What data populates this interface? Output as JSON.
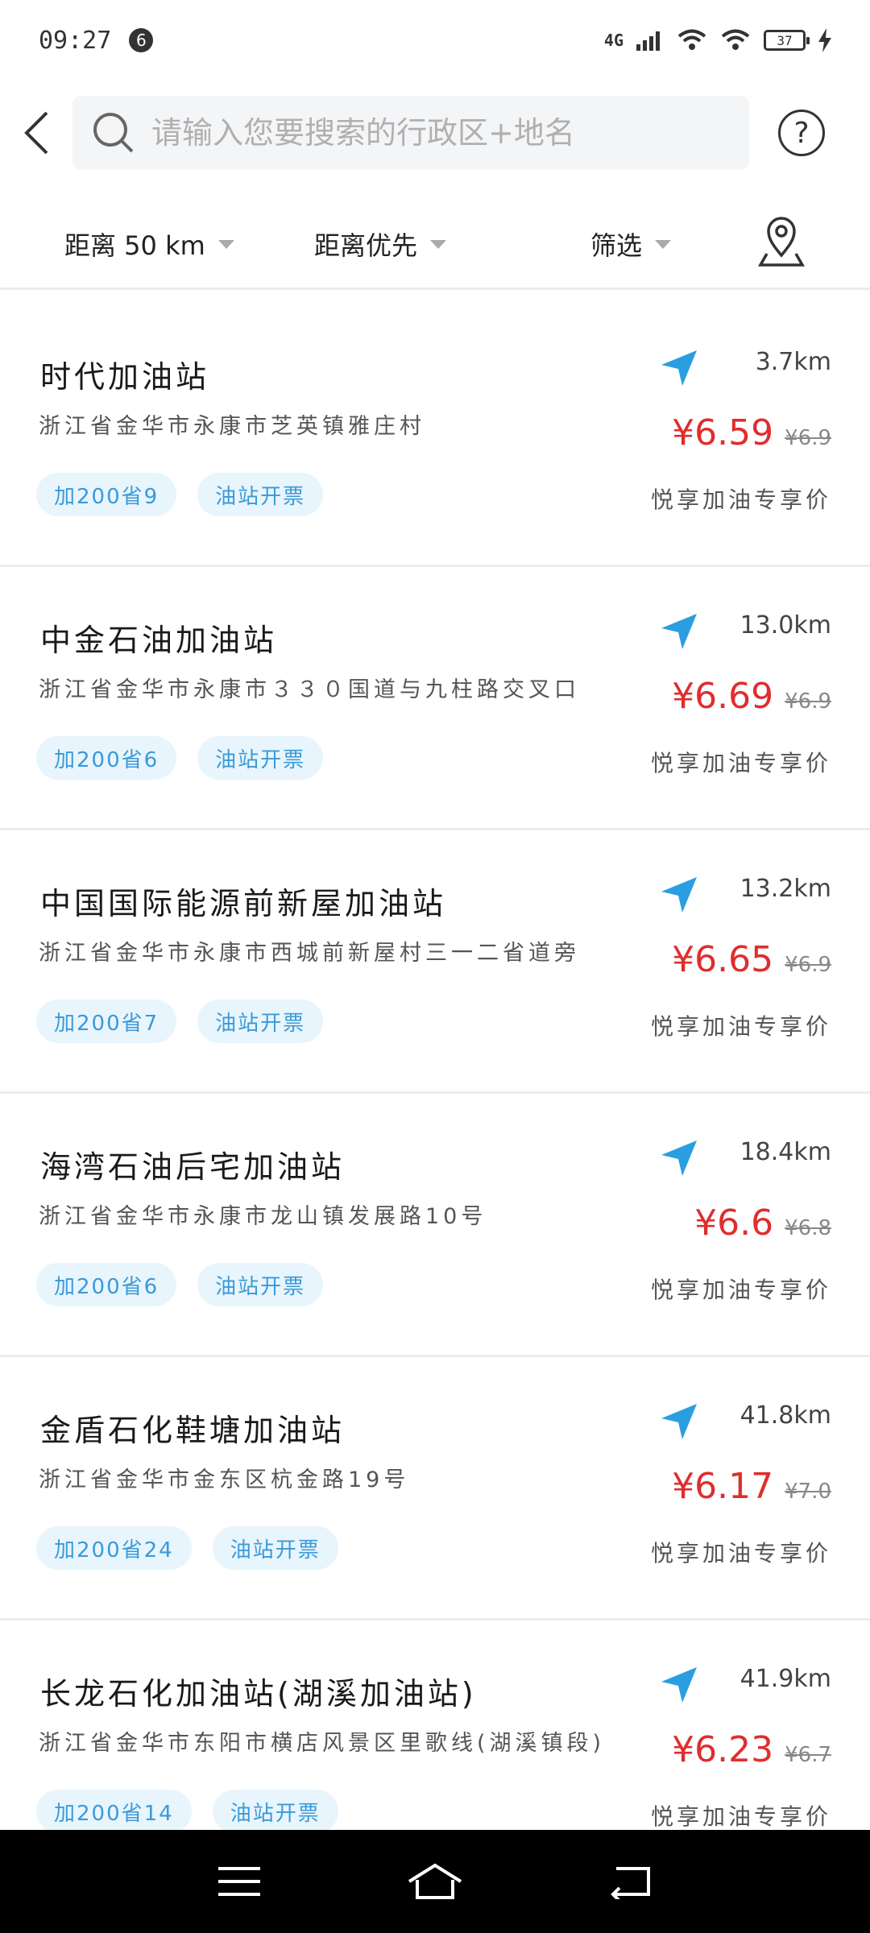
{
  "status": {
    "time": "09:27",
    "notif_count": "6",
    "network": "4G",
    "battery": "37"
  },
  "search": {
    "placeholder": "请输入您要搜索的行政区+地名",
    "help": "?"
  },
  "filters": {
    "distance": "距离 50 km",
    "sort": "距离优先",
    "filter": "筛选"
  },
  "stations": [
    {
      "name": "时代加油站",
      "address": "浙江省金华市永康市芝英镇雅庄村",
      "distance": "3.7km",
      "price": "¥6.59",
      "original_price": "¥6.9",
      "tag_discount": "加200省9",
      "tag_invoice": "油站开票",
      "promo": "悦享加油专享价"
    },
    {
      "name": "中金石油加油站",
      "address": "浙江省金华市永康市３３０国道与九柱路交叉口",
      "distance": "13.0km",
      "price": "¥6.69",
      "original_price": "¥6.9",
      "tag_discount": "加200省6",
      "tag_invoice": "油站开票",
      "promo": "悦享加油专享价"
    },
    {
      "name": "中国国际能源前新屋加油站",
      "address": "浙江省金华市永康市西城前新屋村三一二省道旁",
      "distance": "13.2km",
      "price": "¥6.65",
      "original_price": "¥6.9",
      "tag_discount": "加200省7",
      "tag_invoice": "油站开票",
      "promo": "悦享加油专享价"
    },
    {
      "name": "海湾石油后宅加油站",
      "address": "浙江省金华市永康市龙山镇发展路10号",
      "distance": "18.4km",
      "price": "¥6.6",
      "original_price": "¥6.8",
      "tag_discount": "加200省6",
      "tag_invoice": "油站开票",
      "promo": "悦享加油专享价"
    },
    {
      "name": "金盾石化鞋塘加油站",
      "address": "浙江省金华市金东区杭金路19号",
      "distance": "41.8km",
      "price": "¥6.17",
      "original_price": "¥7.0",
      "tag_discount": "加200省24",
      "tag_invoice": "油站开票",
      "promo": "悦享加油专享价"
    },
    {
      "name": "长龙石化加油站(湖溪加油站)",
      "address": "浙江省金华市东阳市横店风景区里歌线(湖溪镇段)",
      "distance": "41.9km",
      "price": "¥6.23",
      "original_price": "¥6.7",
      "tag_discount": "加200省14",
      "tag_invoice": "油站开票",
      "promo": "悦享加油专享价"
    }
  ],
  "colors": {
    "price": "#e02d2d",
    "accent": "#3a9ad8",
    "tag_bg": "#e8f5fd"
  }
}
